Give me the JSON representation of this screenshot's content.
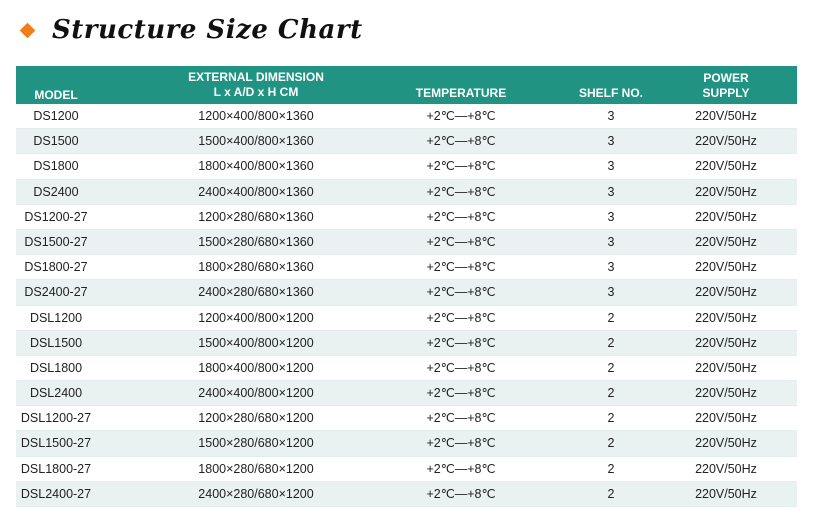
{
  "title": "Structure Size Chart",
  "header": {
    "model": "MODEL",
    "dimension_line1": "EXTERNAL DIMENSION",
    "dimension_line2": "L x A/D x H CM",
    "temperature": "TEMPERATURE",
    "shelf": "SHELF NO.",
    "power_line1": "POWER",
    "power_line2": "SUPPLY"
  },
  "rows": [
    {
      "model": "DS1200",
      "dimension": "1200×400/800×1360",
      "temperature": "+2℃—+8℃",
      "shelf": "3",
      "power": "220V/50Hz"
    },
    {
      "model": "DS1500",
      "dimension": "1500×400/800×1360",
      "temperature": "+2℃—+8℃",
      "shelf": "3",
      "power": "220V/50Hz"
    },
    {
      "model": "DS1800",
      "dimension": "1800×400/800×1360",
      "temperature": "+2℃—+8℃",
      "shelf": "3",
      "power": "220V/50Hz"
    },
    {
      "model": "DS2400",
      "dimension": "2400×400/800×1360",
      "temperature": "+2℃—+8℃",
      "shelf": "3",
      "power": "220V/50Hz"
    },
    {
      "model": "DS1200-27",
      "dimension": "1200×280/680×1360",
      "temperature": "+2℃—+8℃",
      "shelf": "3",
      "power": "220V/50Hz"
    },
    {
      "model": "DS1500-27",
      "dimension": "1500×280/680×1360",
      "temperature": "+2℃—+8℃",
      "shelf": "3",
      "power": "220V/50Hz"
    },
    {
      "model": "DS1800-27",
      "dimension": "1800×280/680×1360",
      "temperature": "+2℃—+8℃",
      "shelf": "3",
      "power": "220V/50Hz"
    },
    {
      "model": "DS2400-27",
      "dimension": "2400×280/680×1360",
      "temperature": "+2℃—+8℃",
      "shelf": "3",
      "power": "220V/50Hz"
    },
    {
      "model": "DSL1200",
      "dimension": "1200×400/800×1200",
      "temperature": "+2℃—+8℃",
      "shelf": "2",
      "power": "220V/50Hz"
    },
    {
      "model": "DSL1500",
      "dimension": "1500×400/800×1200",
      "temperature": "+2℃—+8℃",
      "shelf": "2",
      "power": "220V/50Hz"
    },
    {
      "model": "DSL1800",
      "dimension": "1800×400/800×1200",
      "temperature": "+2℃—+8℃",
      "shelf": "2",
      "power": "220V/50Hz"
    },
    {
      "model": "DSL2400",
      "dimension": "2400×400/800×1200",
      "temperature": "+2℃—+8℃",
      "shelf": "2",
      "power": "220V/50Hz"
    },
    {
      "model": "DSL1200-27",
      "dimension": "1200×280/680×1200",
      "temperature": "+2℃—+8℃",
      "shelf": "2",
      "power": "220V/50Hz"
    },
    {
      "model": "DSL1500-27",
      "dimension": "1500×280/680×1200",
      "temperature": "+2℃—+8℃",
      "shelf": "2",
      "power": "220V/50Hz"
    },
    {
      "model": "DSL1800-27",
      "dimension": "1800×280/680×1200",
      "temperature": "+2℃—+8℃",
      "shelf": "2",
      "power": "220V/50Hz"
    },
    {
      "model": "DSL2400-27",
      "dimension": "2400×280/680×1200",
      "temperature": "+2℃—+8℃",
      "shelf": "2",
      "power": "220V/50Hz"
    }
  ],
  "colors": {
    "accent": "#219383",
    "bullet": "#f07d1a",
    "row_alt": "#e9f1f1"
  }
}
